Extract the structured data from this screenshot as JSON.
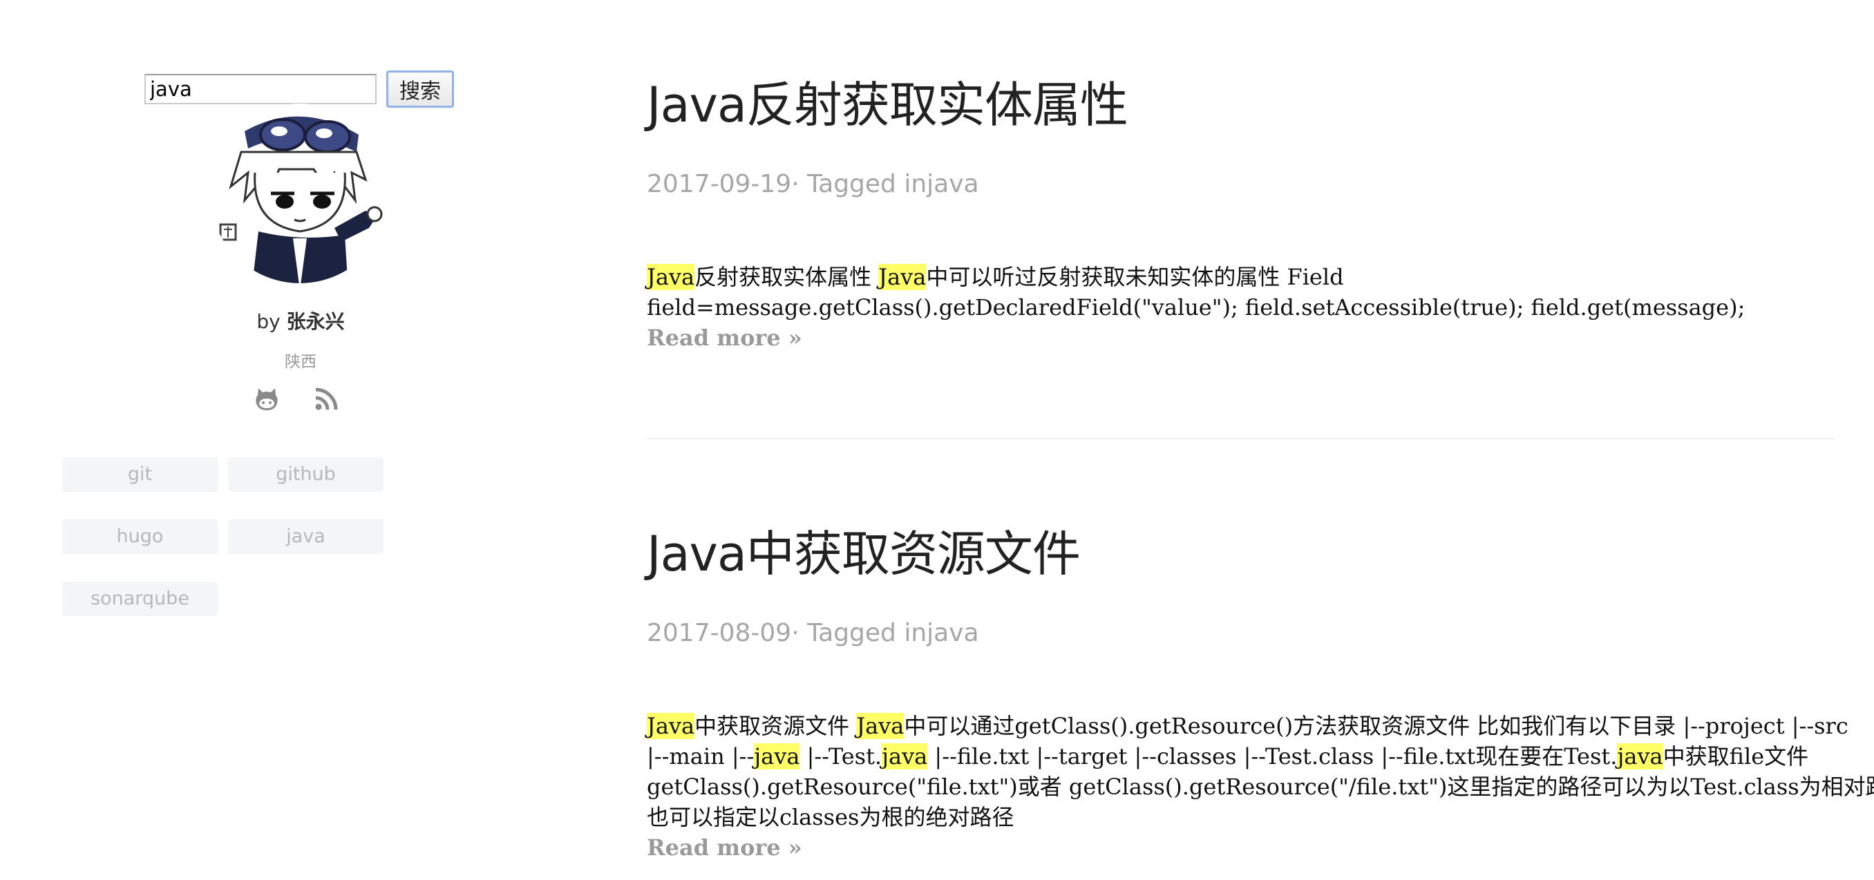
{
  "search": {
    "value": "java",
    "button_label": "搜索"
  },
  "profile": {
    "by_label": "by",
    "author_name": "张永兴",
    "location": "陕西",
    "social_icons": [
      "github-icon",
      "rss-icon"
    ]
  },
  "tags": [
    "git",
    "github",
    "hugo",
    "java",
    "sonarqube"
  ],
  "posts": [
    {
      "title": "Java反射获取实体属性",
      "date": "2017-09-19",
      "meta_sep": "· Tagged ",
      "tag": "injava",
      "summary": {
        "line1_a_hl": "Java",
        "line1_b": "反射获取实体属性 ",
        "line1_c_hl": "Java",
        "line1_d": "中可以听过反射获取未知实体的属性 Field",
        "line2": "field=message.getClass().getDeclaredField(\"value\"); field.setAccessible(true); field.get(message);"
      },
      "read_more": "Read more »"
    },
    {
      "title": "Java中获取资源文件",
      "date": "2017-08-09",
      "meta_sep": "· Tagged ",
      "tag": "injava",
      "summary": {
        "line1_a_hl": "Java",
        "line1_b": "中获取资源文件 ",
        "line1_c_hl": "Java",
        "line1_d": "中可以通过getClass().getResource()方法获取资源文件 比如我们有以下目录 |--project |--src",
        "line2_a": "|--main |--",
        "line2_b_hl": "java",
        "line2_c": " |--Test.",
        "line2_d_hl": "java",
        "line2_e": " |--file.txt |--target |--classes |--Test.class |--file.txt现在要在Test.",
        "line2_f_hl": "java",
        "line2_g": "中获取file文件",
        "line3": "getClass().getResource(\"file.txt\")或者 getClass().getResource(\"/file.txt\")这里指定的路径可以为以Test.class为相对路径",
        "line4": "也可以指定以classes为根的绝对路径"
      },
      "read_more": "Read more »"
    }
  ],
  "colors": {
    "highlight": "#ffff66",
    "meta_gray": "#a6a6a6",
    "tag_bg": "#f4f5f7",
    "tag_text": "#b5b8bd"
  }
}
